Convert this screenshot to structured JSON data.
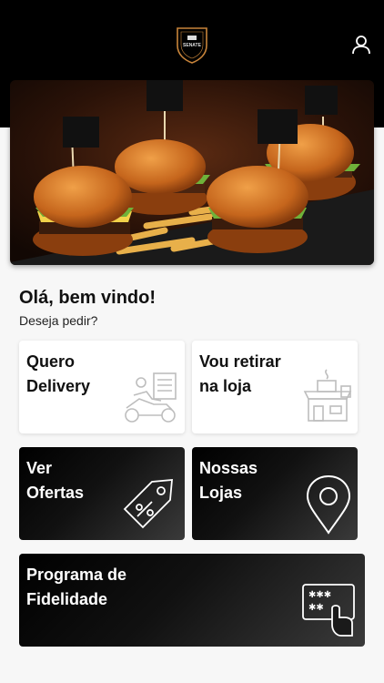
{
  "header": {
    "logo_text": "SENATE",
    "icons": {
      "logo": "brand-shield-logo",
      "user": "user-icon"
    }
  },
  "hero": {
    "image": "burgers-photo"
  },
  "greeting": {
    "title": "Olá, bem vindo!",
    "subtitle": "Deseja pedir?"
  },
  "cards": [
    {
      "label": "Quero\nDelivery",
      "icon": "delivery-scooter-icon",
      "style": "light"
    },
    {
      "label": "Vou retirar\nna loja",
      "icon": "store-pickup-icon",
      "style": "light"
    },
    {
      "label": "Ver\nOfertas",
      "icon": "discount-tag-icon",
      "style": "dark"
    },
    {
      "label": "Nossas\nLojas",
      "icon": "map-pin-icon",
      "style": "dark"
    },
    {
      "label": "Programa de\nFidelidade",
      "icon": "loyalty-card-icon",
      "style": "dark"
    }
  ],
  "colors": {
    "header_bg": "#000000",
    "page_bg": "#f7f7f7",
    "accent": "#c8843a",
    "dark_card": "#111111"
  }
}
